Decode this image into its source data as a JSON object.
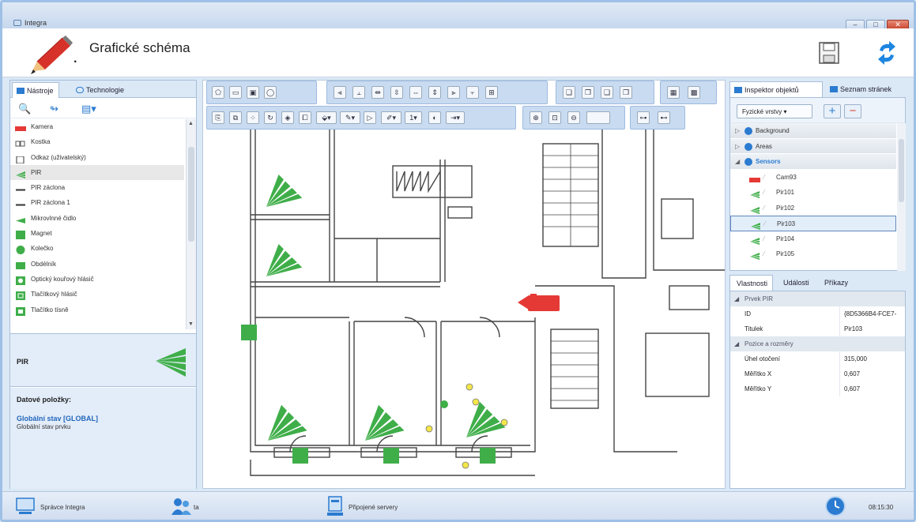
{
  "window": {
    "title": "Integra",
    "controls": [
      "–",
      "□",
      "✕"
    ]
  },
  "header": {
    "title": "Grafické schéma",
    "dot": "."
  },
  "left_panel": {
    "tabs": [
      {
        "label": "Nástroje",
        "active": true
      },
      {
        "label": "Technologie",
        "active": false
      }
    ],
    "items": [
      {
        "label": "Kamera",
        "icon": "camera-icon"
      },
      {
        "label": "Kostka",
        "icon": "cube-icon"
      },
      {
        "label": "Odkaz (uživatelský)",
        "icon": "link-icon"
      },
      {
        "label": "PIR",
        "icon": "pir-icon",
        "selected": true
      },
      {
        "label": "PIR záclona",
        "icon": "pir-curtain-icon"
      },
      {
        "label": "PIR záclona 1",
        "icon": "pir-curtain-icon"
      },
      {
        "label": "Mikrovlnné čidlo",
        "icon": "microwave-icon"
      },
      {
        "label": "Magnet",
        "icon": "magnet-icon"
      },
      {
        "label": "Kolečko",
        "icon": "circle-icon"
      },
      {
        "label": "Obdélník",
        "icon": "rectangle-icon"
      },
      {
        "label": "Optický kouřový hlásič",
        "icon": "smoke-detector-icon"
      },
      {
        "label": "Tlačítkový hlásič",
        "icon": "button-detector-icon"
      },
      {
        "label": "Tlačítko tísně",
        "icon": "panic-button-icon"
      }
    ],
    "preview_label": "PIR",
    "data_items_heading": "Datové položky:",
    "data_link": "Globální stav [GLOBAL]",
    "data_sub": "Globální stav prvku"
  },
  "right_panel": {
    "tabs": [
      {
        "label": "Inspektor objektů",
        "active": true
      },
      {
        "label": "Seznam stránek",
        "active": false
      }
    ],
    "layer_combo": "Fyzické vrstvy",
    "tree": [
      {
        "label": "Background",
        "type": "group",
        "expanded": false
      },
      {
        "label": "Areas",
        "type": "group",
        "expanded": false
      },
      {
        "label": "Sensors",
        "type": "group",
        "expanded": true
      },
      {
        "label": "Cam93",
        "type": "camera"
      },
      {
        "label": "Pir101",
        "type": "pir"
      },
      {
        "label": "Pir102",
        "type": "pir"
      },
      {
        "label": "Pir103",
        "type": "pir",
        "selected": true
      },
      {
        "label": "Pir104",
        "type": "pir"
      },
      {
        "label": "Pir105",
        "type": "pir"
      }
    ],
    "prop_tabs": [
      {
        "label": "Vlastnosti",
        "active": true
      },
      {
        "label": "Události",
        "active": false
      },
      {
        "label": "Příkazy",
        "active": false
      }
    ],
    "properties": [
      {
        "category": "Prvek PIR"
      },
      {
        "key": "ID",
        "value": "{8D5366B4-FCE7-"
      },
      {
        "key": "Titulek",
        "value": "Pir103"
      },
      {
        "category": "Pozice a rozměry"
      },
      {
        "key": "Úhel otočení",
        "value": "315,000"
      },
      {
        "key": "Měřítko X",
        "value": "0,607"
      },
      {
        "key": "Měřítko Y",
        "value": "0,607"
      }
    ]
  },
  "statusbar": {
    "user_label": "Správce Integra",
    "user_short": "ta",
    "servers_label": "Připojené servery",
    "clock": "08:15:30"
  },
  "colors": {
    "pir_green": "#3fae49",
    "camera_red": "#e53935",
    "panel_blue": "#dbe8f6",
    "accent_blue": "#2b7bd0"
  }
}
